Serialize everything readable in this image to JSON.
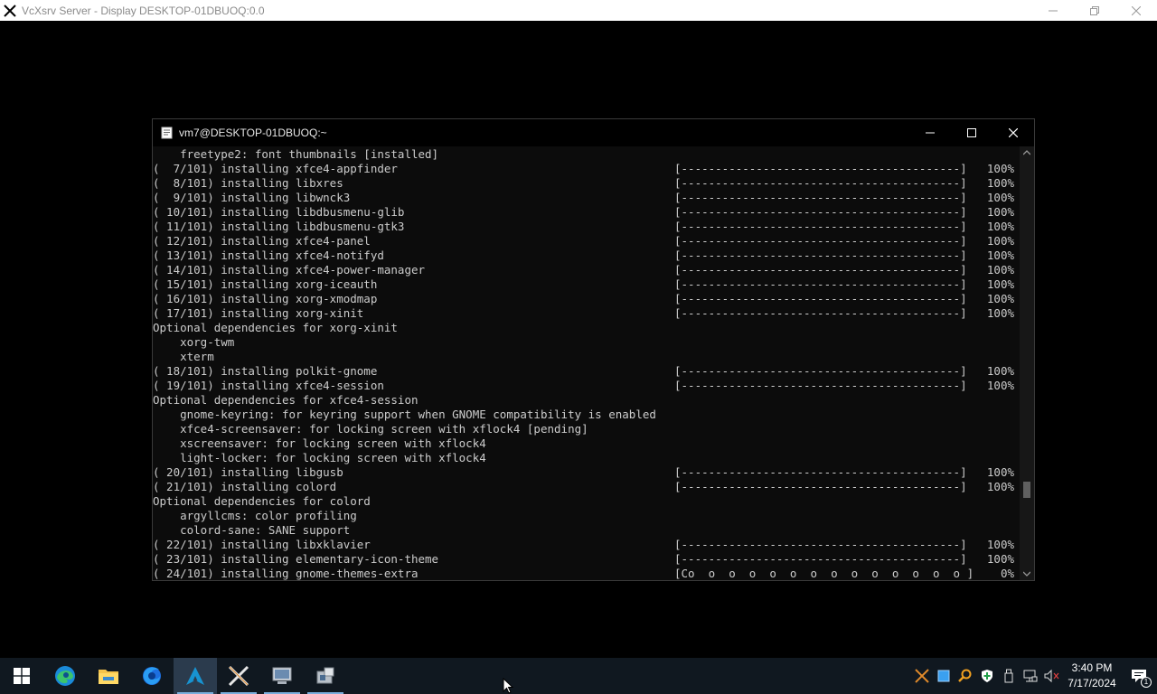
{
  "outer_window": {
    "title": "VcXsrv Server - Display DESKTOP-01DBUOQ:0.0"
  },
  "terminal": {
    "title": "vm7@DESKTOP-01DBUOQ:~",
    "lines": [
      {
        "text": "    freetype2: font thumbnails [installed]",
        "bar": "",
        "pct": ""
      },
      {
        "text": "(  7/101) installing xfce4-appfinder",
        "bar": "[-----------------------------------------]",
        "pct": "100%"
      },
      {
        "text": "(  8/101) installing libxres",
        "bar": "[-----------------------------------------]",
        "pct": "100%"
      },
      {
        "text": "(  9/101) installing libwnck3",
        "bar": "[-----------------------------------------]",
        "pct": "100%"
      },
      {
        "text": "( 10/101) installing libdbusmenu-glib",
        "bar": "[-----------------------------------------]",
        "pct": "100%"
      },
      {
        "text": "( 11/101) installing libdbusmenu-gtk3",
        "bar": "[-----------------------------------------]",
        "pct": "100%"
      },
      {
        "text": "( 12/101) installing xfce4-panel",
        "bar": "[-----------------------------------------]",
        "pct": "100%"
      },
      {
        "text": "( 13/101) installing xfce4-notifyd",
        "bar": "[-----------------------------------------]",
        "pct": "100%"
      },
      {
        "text": "( 14/101) installing xfce4-power-manager",
        "bar": "[-----------------------------------------]",
        "pct": "100%"
      },
      {
        "text": "( 15/101) installing xorg-iceauth",
        "bar": "[-----------------------------------------]",
        "pct": "100%"
      },
      {
        "text": "( 16/101) installing xorg-xmodmap",
        "bar": "[-----------------------------------------]",
        "pct": "100%"
      },
      {
        "text": "( 17/101) installing xorg-xinit",
        "bar": "[-----------------------------------------]",
        "pct": "100%"
      },
      {
        "text": "Optional dependencies for xorg-xinit",
        "bar": "",
        "pct": ""
      },
      {
        "text": "    xorg-twm",
        "bar": "",
        "pct": ""
      },
      {
        "text": "    xterm",
        "bar": "",
        "pct": ""
      },
      {
        "text": "( 18/101) installing polkit-gnome",
        "bar": "[-----------------------------------------]",
        "pct": "100%"
      },
      {
        "text": "( 19/101) installing xfce4-session",
        "bar": "[-----------------------------------------]",
        "pct": "100%"
      },
      {
        "text": "Optional dependencies for xfce4-session",
        "bar": "",
        "pct": ""
      },
      {
        "text": "    gnome-keyring: for keyring support when GNOME compatibility is enabled",
        "bar": "",
        "pct": ""
      },
      {
        "text": "    xfce4-screensaver: for locking screen with xflock4 [pending]",
        "bar": "",
        "pct": ""
      },
      {
        "text": "    xscreensaver: for locking screen with xflock4",
        "bar": "",
        "pct": ""
      },
      {
        "text": "    light-locker: for locking screen with xflock4",
        "bar": "",
        "pct": ""
      },
      {
        "text": "( 20/101) installing libgusb",
        "bar": "[-----------------------------------------]",
        "pct": "100%"
      },
      {
        "text": "( 21/101) installing colord",
        "bar": "[-----------------------------------------]",
        "pct": "100%"
      },
      {
        "text": "Optional dependencies for colord",
        "bar": "",
        "pct": ""
      },
      {
        "text": "    argyllcms: color profiling",
        "bar": "",
        "pct": ""
      },
      {
        "text": "    colord-sane: SANE support",
        "bar": "",
        "pct": ""
      },
      {
        "text": "( 22/101) installing libxklavier",
        "bar": "[-----------------------------------------]",
        "pct": "100%"
      },
      {
        "text": "( 23/101) installing elementary-icon-theme",
        "bar": "[-----------------------------------------]",
        "pct": "100%"
      },
      {
        "text": "( 24/101) installing gnome-themes-extra",
        "bar": "[Co  o  o  o  o  o  o  o  o  o  o  o  o  o ]",
        "pct": "0%"
      }
    ]
  },
  "taskbar": {
    "apps": [
      {
        "name": "start-button",
        "icon": "windows-logo-icon",
        "active": false,
        "running": false
      },
      {
        "name": "taskbar-edge",
        "icon": "edge-icon",
        "active": false,
        "running": false
      },
      {
        "name": "taskbar-file-explorer",
        "icon": "folder-icon",
        "active": false,
        "running": false
      },
      {
        "name": "taskbar-firefox",
        "icon": "firefox-icon",
        "active": false,
        "running": false
      },
      {
        "name": "taskbar-arch-terminal",
        "icon": "arch-linux-icon",
        "active": true,
        "running": true
      },
      {
        "name": "taskbar-vcxsrv",
        "icon": "x-server-icon",
        "active": false,
        "running": true
      },
      {
        "name": "taskbar-app-7",
        "icon": "computer-icon",
        "active": false,
        "running": true
      },
      {
        "name": "taskbar-app-8",
        "icon": "installer-icon",
        "active": false,
        "running": true
      }
    ],
    "clock": {
      "time": "3:40 PM",
      "date": "7/17/2024"
    },
    "notification_count": "1"
  },
  "colors": {
    "accent": "#7aaedc",
    "terminal_bg": "#0c0c0c",
    "terminal_text": "#cccccc"
  }
}
